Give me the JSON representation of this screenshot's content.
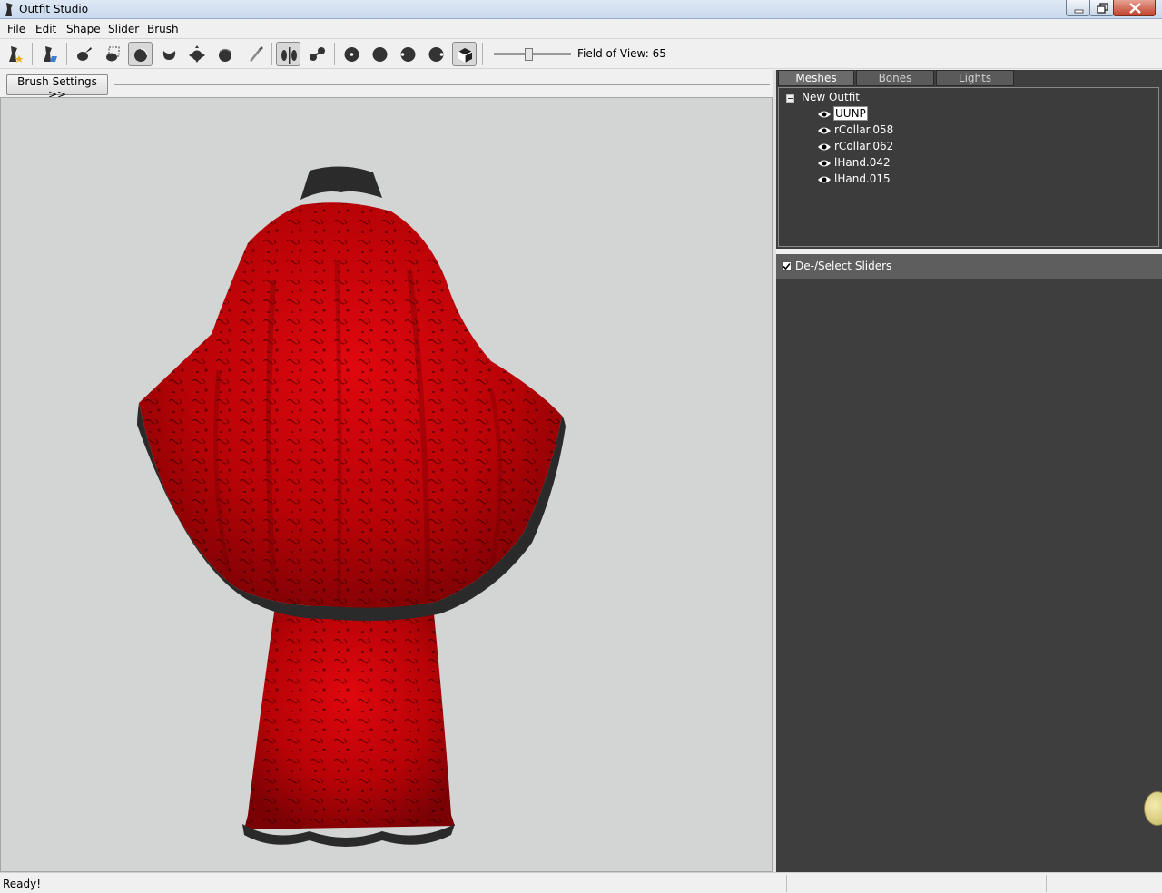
{
  "window": {
    "title": "Outfit Studio"
  },
  "menu": [
    "File",
    "Edit",
    "Shape",
    "Slider",
    "Brush"
  ],
  "toolbar": {
    "icons": [
      "new-outfit-icon",
      "load-outfit-icon",
      "select-brush-icon",
      "mask-brush-icon",
      "inflate-brush-icon",
      "deflate-brush-icon",
      "move-brush-icon",
      "smooth-brush-icon",
      "weight-brush-icon",
      "mirror-x-icon",
      "connected-only-icon",
      "view-front-icon",
      "view-back-icon",
      "view-left-icon",
      "view-right-icon",
      "perspective-icon"
    ],
    "fov_label": "Field of View: 65",
    "fov_value": 65
  },
  "left": {
    "brush_settings_label": "Brush Settings >>"
  },
  "right": {
    "tabs": [
      "Meshes",
      "Bones",
      "Lights"
    ],
    "active_tab": "Meshes",
    "tree": {
      "root": "New Outfit",
      "items": [
        "UUNP",
        "rCollar.058",
        "rCollar.062",
        "lHand.042",
        "lHand.015"
      ],
      "selected": "UUNP"
    },
    "sliders_header": "De-/Select Sliders",
    "sliders_checked": true
  },
  "status": {
    "text": "Ready!"
  },
  "colors": {
    "garment": "#c8050a",
    "trim": "#2a2a2a",
    "viewport_bg": "#d3d4d4",
    "panel_bg": "#3f3f3f"
  }
}
